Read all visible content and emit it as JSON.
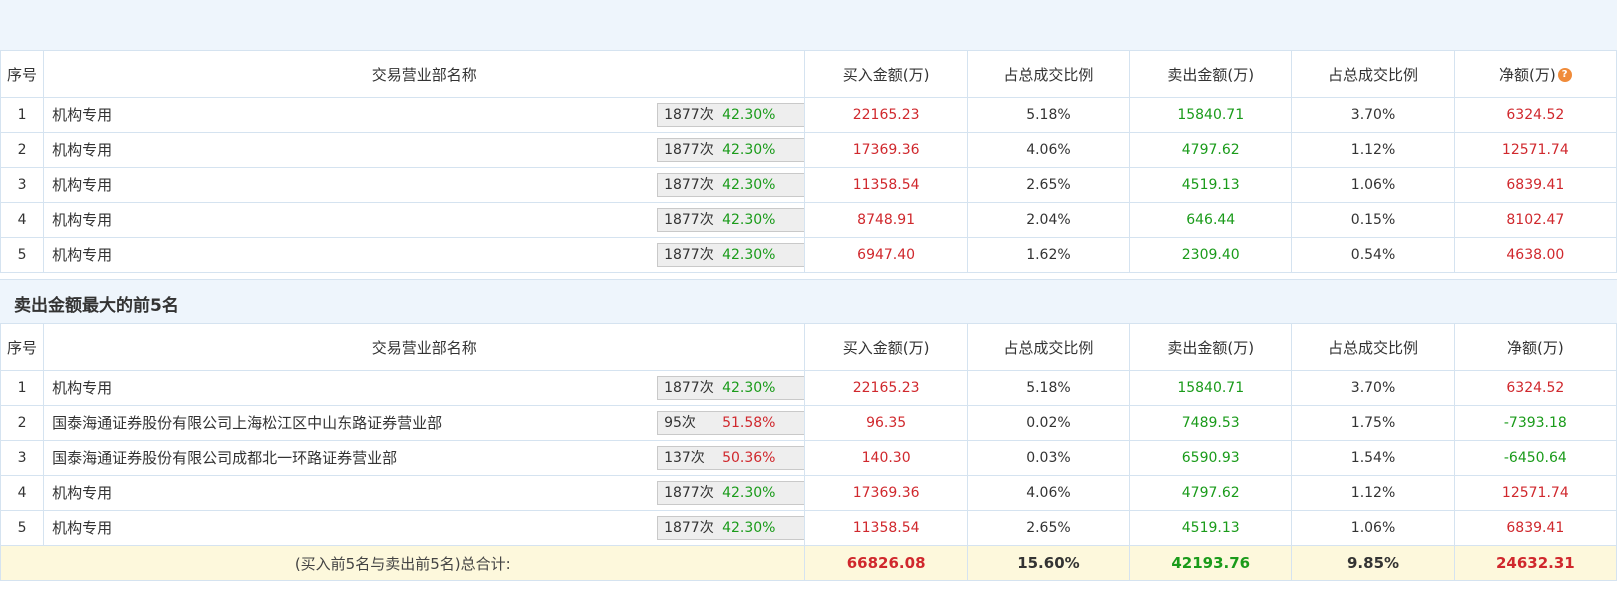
{
  "headers": [
    "序号",
    "交易营业部名称",
    "买入金额(万)",
    "占总成交比例",
    "卖出金额(万)",
    "占总成交比例",
    "净额(万)"
  ],
  "buy_table": {
    "rows": [
      {
        "rank": "1",
        "name": "机构专用",
        "count": "1877次",
        "pct": "42.30%",
        "pct_color": "green",
        "icon": "question-icon",
        "buy": "22165.23",
        "buy_ratio": "5.18%",
        "sell": "15840.71",
        "sell_ratio": "3.70%",
        "net": "6324.52",
        "net_color": "red"
      },
      {
        "rank": "2",
        "name": "机构专用",
        "count": "1877次",
        "pct": "42.30%",
        "pct_color": "green",
        "icon": "arrow-icon",
        "buy": "17369.36",
        "buy_ratio": "4.06%",
        "sell": "4797.62",
        "sell_ratio": "1.12%",
        "net": "12571.74",
        "net_color": "red"
      },
      {
        "rank": "3",
        "name": "机构专用",
        "count": "1877次",
        "pct": "42.30%",
        "pct_color": "green",
        "icon": "arrow-icon",
        "buy": "11358.54",
        "buy_ratio": "2.65%",
        "sell": "4519.13",
        "sell_ratio": "1.06%",
        "net": "6839.41",
        "net_color": "red"
      },
      {
        "rank": "4",
        "name": "机构专用",
        "count": "1877次",
        "pct": "42.30%",
        "pct_color": "green",
        "icon": "arrow-icon",
        "buy": "8748.91",
        "buy_ratio": "2.04%",
        "sell": "646.44",
        "sell_ratio": "0.15%",
        "net": "8102.47",
        "net_color": "red"
      },
      {
        "rank": "5",
        "name": "机构专用",
        "count": "1877次",
        "pct": "42.30%",
        "pct_color": "green",
        "icon": "arrow-icon",
        "buy": "6947.40",
        "buy_ratio": "1.62%",
        "sell": "2309.40",
        "sell_ratio": "0.54%",
        "net": "4638.00",
        "net_color": "red"
      }
    ]
  },
  "sell_section_title": "卖出金额最大的前5名",
  "sell_table": {
    "rows": [
      {
        "rank": "1",
        "name": "机构专用",
        "count": "1877次",
        "pct": "42.30%",
        "pct_color": "green",
        "icon": "question-icon",
        "buy": "22165.23",
        "buy_ratio": "5.18%",
        "sell": "15840.71",
        "sell_ratio": "3.70%",
        "net": "6324.52",
        "net_color": "red"
      },
      {
        "rank": "2",
        "name": "国泰海通证券股份有限公司上海松江区中山东路证券营业部",
        "count": "95次",
        "pct": "51.58%",
        "pct_color": "red",
        "icon": "arrow-icon",
        "buy": "96.35",
        "buy_ratio": "0.02%",
        "sell": "7489.53",
        "sell_ratio": "1.75%",
        "net": "-7393.18",
        "net_color": "green"
      },
      {
        "rank": "3",
        "name": "国泰海通证券股份有限公司成都北一环路证券营业部",
        "count": "137次",
        "pct": "50.36%",
        "pct_color": "red",
        "icon": "arrow-icon",
        "buy": "140.30",
        "buy_ratio": "0.03%",
        "sell": "6590.93",
        "sell_ratio": "1.54%",
        "net": "-6450.64",
        "net_color": "green"
      },
      {
        "rank": "4",
        "name": "机构专用",
        "count": "1877次",
        "pct": "42.30%",
        "pct_color": "green",
        "icon": "arrow-icon",
        "buy": "17369.36",
        "buy_ratio": "4.06%",
        "sell": "4797.62",
        "sell_ratio": "1.12%",
        "net": "12571.74",
        "net_color": "red"
      },
      {
        "rank": "5",
        "name": "机构专用",
        "count": "1877次",
        "pct": "42.30%",
        "pct_color": "green",
        "icon": "arrow-icon",
        "buy": "11358.54",
        "buy_ratio": "2.65%",
        "sell": "4519.13",
        "sell_ratio": "1.06%",
        "net": "6839.41",
        "net_color": "red"
      }
    ]
  },
  "total": {
    "label": "(买入前5名与卖出前5名)总合计:",
    "buy": "66826.08",
    "buy_ratio": "15.60%",
    "sell": "42193.76",
    "sell_ratio": "9.85%",
    "net": "24632.31"
  },
  "colors": {
    "buy": "#d0282d",
    "sell": "#1a9b1a",
    "section_bg": "#eef5fc",
    "total_bg": "#fdf8dc"
  }
}
